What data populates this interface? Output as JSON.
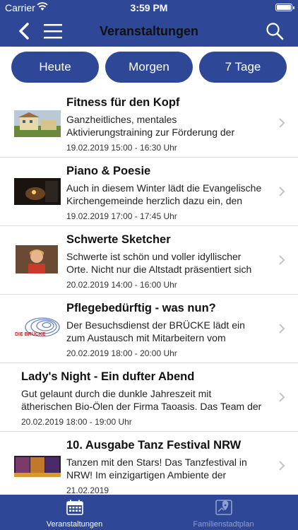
{
  "status_bar": {
    "carrier": "Carrier",
    "time": "3:59 PM"
  },
  "nav": {
    "title": "Veranstaltungen"
  },
  "filters": [
    "Heute",
    "Morgen",
    "7 Tage"
  ],
  "events": [
    {
      "title": "Fitness für den Kopf",
      "description": "Ganzheitliches, mentales Aktivierungstraining zur Förderung der geistigen Leistungsfähigk…",
      "date": "19.02.2019 15:00 - 16:30 Uhr"
    },
    {
      "title": "Piano & Poesie",
      "description": "Auch in diesem Winter lädt die Evangelische Kirchengemeinde herzlich dazu ein, den Allt…",
      "date": "19.02.2019 17:00 - 17:45 Uhr"
    },
    {
      "title": "Schwerte Sketcher",
      "description": "Schwerte ist schön und voller idyllischer Orte. Nicht nur die Altstadt präsentiert sich mit wu…",
      "date": "20.02.2019 14:00 - 16:00 Uhr"
    },
    {
      "title": "Pflegebedürftig - was nun?",
      "description": "Der Besuchsdienst der BRÜCKE lädt ein zum Austausch mit Mitarbeitern vom Pflegestütz…",
      "date": "20.02.2019 18:00 - 20:00 Uhr",
      "logo_text": "DIE BRÜCKE"
    },
    {
      "title": "Lady's Night - Ein dufter Abend",
      "description": "Gut gelaunt durch die dunkle Jahreszeit mit ätherischen Bio-Ölen der Firma Taoasis. Das Team der Bahnhof-Ap…",
      "date": "20.02.2019 18:00 - 19:00 Uhr"
    },
    {
      "title": "10. Ausgabe Tanz Festival NRW",
      "description": "Tanzen mit den Stars! Das Tanzfestival in NRW! Im einzigartigen Ambiente der Rohrmeister…",
      "date": "21.02.2019"
    }
  ],
  "tabs": [
    {
      "label": "Veranstaltungen",
      "icon": "calendar-icon",
      "active": true
    },
    {
      "label": "Familienstadtplan",
      "icon": "map-pin-icon",
      "active": false
    }
  ],
  "colors": {
    "primary": "#2e4796",
    "inactive_tab": "#8ea0cf"
  }
}
